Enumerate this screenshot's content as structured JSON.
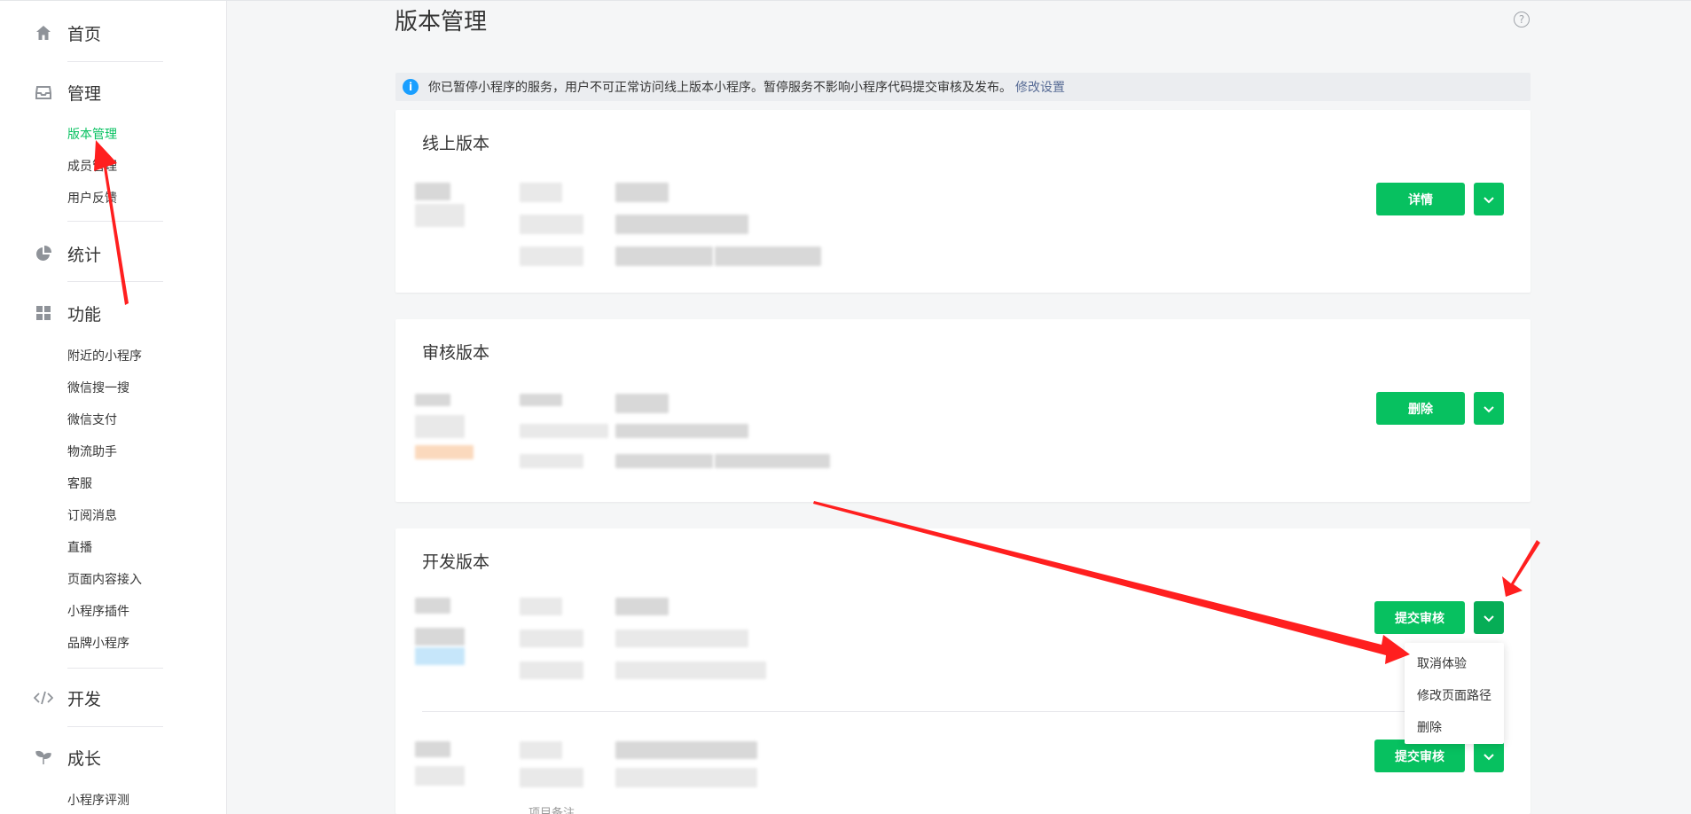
{
  "sidebar": {
    "home": "首页",
    "manage": "管理",
    "manage_items": [
      "版本管理",
      "成员管理",
      "用户反馈"
    ],
    "stats": "统计",
    "features": "功能",
    "feature_items": [
      "附近的小程序",
      "微信搜一搜",
      "微信支付",
      "物流助手",
      "客服",
      "订阅消息",
      "直播",
      "页面内容接入",
      "小程序插件",
      "品牌小程序"
    ],
    "develop": "开发",
    "growth": "成长",
    "growth_items": [
      "小程序评测"
    ]
  },
  "main": {
    "title": "版本管理",
    "help": "?",
    "notice": {
      "text": "你已暂停小程序的服务，用户不可正常访问线上版本小程序。暂停服务不影响小程序代码提交审核及发布。",
      "link": "修改设置"
    },
    "online": {
      "title": "线上版本",
      "button": "详情"
    },
    "review": {
      "title": "审核版本",
      "button": "删除"
    },
    "dev": {
      "title": "开发版本",
      "button": "提交审核",
      "button2": "提交审核",
      "note_label": "项目备注"
    },
    "dropdown": [
      "取消体验",
      "修改页面路径",
      "删除"
    ]
  },
  "colors": {
    "accent": "#07c160",
    "link": "#576b95",
    "annotation": "#ff1f1f"
  }
}
